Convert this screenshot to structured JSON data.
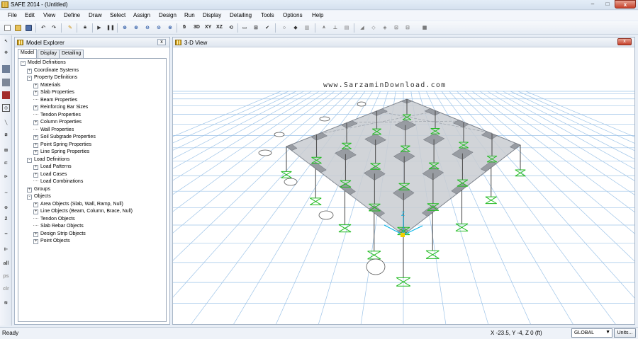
{
  "window": {
    "title": "SAFE 2014 - (Untitled)",
    "minimize": "–",
    "maximize": "□",
    "close": "x"
  },
  "menu": [
    "File",
    "Edit",
    "View",
    "Define",
    "Draw",
    "Select",
    "Assign",
    "Design",
    "Run",
    "Display",
    "Detailing",
    "Tools",
    "Options",
    "Help"
  ],
  "toolbar": {
    "icons": [
      "new-file-icon",
      "open-folder-icon",
      "save-icon",
      "undo-icon",
      "redo-icon",
      "pencil-icon",
      "lock-icon",
      "run-icon",
      "pause-icon",
      "zoom-window-icon",
      "zoom-in-icon",
      "zoom-out-icon",
      "zoom-full-icon",
      "pan-icon",
      "hand-icon"
    ],
    "view_labels": [
      "3D",
      "XY",
      "XZ"
    ],
    "icons_right": [
      "rotate-3d-icon",
      "perspective-icon",
      "grid-view-icon",
      "check-icon",
      "circle-icon",
      "cube-icon",
      "clear-icon",
      "show-loads-icon",
      "support-icon",
      "slab-icon",
      "beam-icon",
      "frame-icon",
      "strip-icon",
      "section-cut-icon",
      "table-icon"
    ]
  },
  "left_toolbar": {
    "icons": [
      "pointer-icon",
      "reshape-icon",
      "draw-slab-icon",
      "draw-rectangle-icon",
      "draw-area-icon",
      "draw-opening-icon",
      "draw-line-icon",
      "draw-beam-icon",
      "draw-column-icon",
      "draw-wall-icon",
      "draw-tendon-icon",
      "draw-strip-icon",
      "draw-point-icon",
      "dimension-icon",
      "section-icon",
      "snap-icon"
    ],
    "labels": [
      "2",
      "all",
      "ps",
      "clr"
    ]
  },
  "explorer": {
    "title": "Model Explorer",
    "close": "x",
    "tabs": [
      "Model",
      "Display",
      "Detailing"
    ],
    "tree": [
      {
        "label": "Model Definitions",
        "level": 0,
        "exp": "-"
      },
      {
        "label": "Coordinate Systems",
        "level": 1,
        "exp": "+"
      },
      {
        "label": "Property Definitions",
        "level": 1,
        "exp": "-"
      },
      {
        "label": "Materials",
        "level": 2,
        "exp": "+"
      },
      {
        "label": "Slab Properties",
        "level": 2,
        "exp": "+"
      },
      {
        "label": "Beam Properties",
        "level": 2,
        "exp": ""
      },
      {
        "label": "Reinforcing Bar Sizes",
        "level": 2,
        "exp": "+"
      },
      {
        "label": "Tendon Properties",
        "level": 2,
        "exp": ""
      },
      {
        "label": "Column Properties",
        "level": 2,
        "exp": "+"
      },
      {
        "label": "Wall Properties",
        "level": 2,
        "exp": ""
      },
      {
        "label": "Soil Subgrade Properties",
        "level": 2,
        "exp": "+"
      },
      {
        "label": "Point Spring Properties",
        "level": 2,
        "exp": "+"
      },
      {
        "label": "Line Spring Properties",
        "level": 2,
        "exp": "+"
      },
      {
        "label": "Load Definitions",
        "level": 1,
        "exp": "-"
      },
      {
        "label": "Load Patterns",
        "level": 2,
        "exp": "+"
      },
      {
        "label": "Load Cases",
        "level": 2,
        "exp": "+"
      },
      {
        "label": "Load Combinations",
        "level": 2,
        "exp": ""
      },
      {
        "label": "Groups",
        "level": 1,
        "exp": "+"
      },
      {
        "label": "Objects",
        "level": 1,
        "exp": "-"
      },
      {
        "label": "Area Objects (Slab, Wall, Ramp, Null)",
        "level": 2,
        "exp": "+"
      },
      {
        "label": "Line Objects (Beam, Column, Brace, Null)",
        "level": 2,
        "exp": "+"
      },
      {
        "label": "Tendon Objects",
        "level": 2,
        "exp": ""
      },
      {
        "label": "Slab Rebar Objects",
        "level": 2,
        "exp": ""
      },
      {
        "label": "Design Strip Objects",
        "level": 2,
        "exp": "+"
      },
      {
        "label": "Point Objects",
        "level": 2,
        "exp": "+"
      }
    ]
  },
  "view3d": {
    "title": "3-D View",
    "close": "x",
    "watermark": "www.SarzaminDownload.com",
    "axis_label": "Z"
  },
  "status": {
    "text": "Ready",
    "coords": "X -23.5,  Y -4,  Z 0  (ft)",
    "coord_system": "GLOBAL",
    "units_button": "Units..."
  },
  "colors": {
    "grid": "#9ec4e8",
    "slab": "#c9ccd1",
    "drop_panel": "#8e9299",
    "support": "#22bb22",
    "axis": "#00b3e6",
    "accent_close": "#c7412b"
  }
}
